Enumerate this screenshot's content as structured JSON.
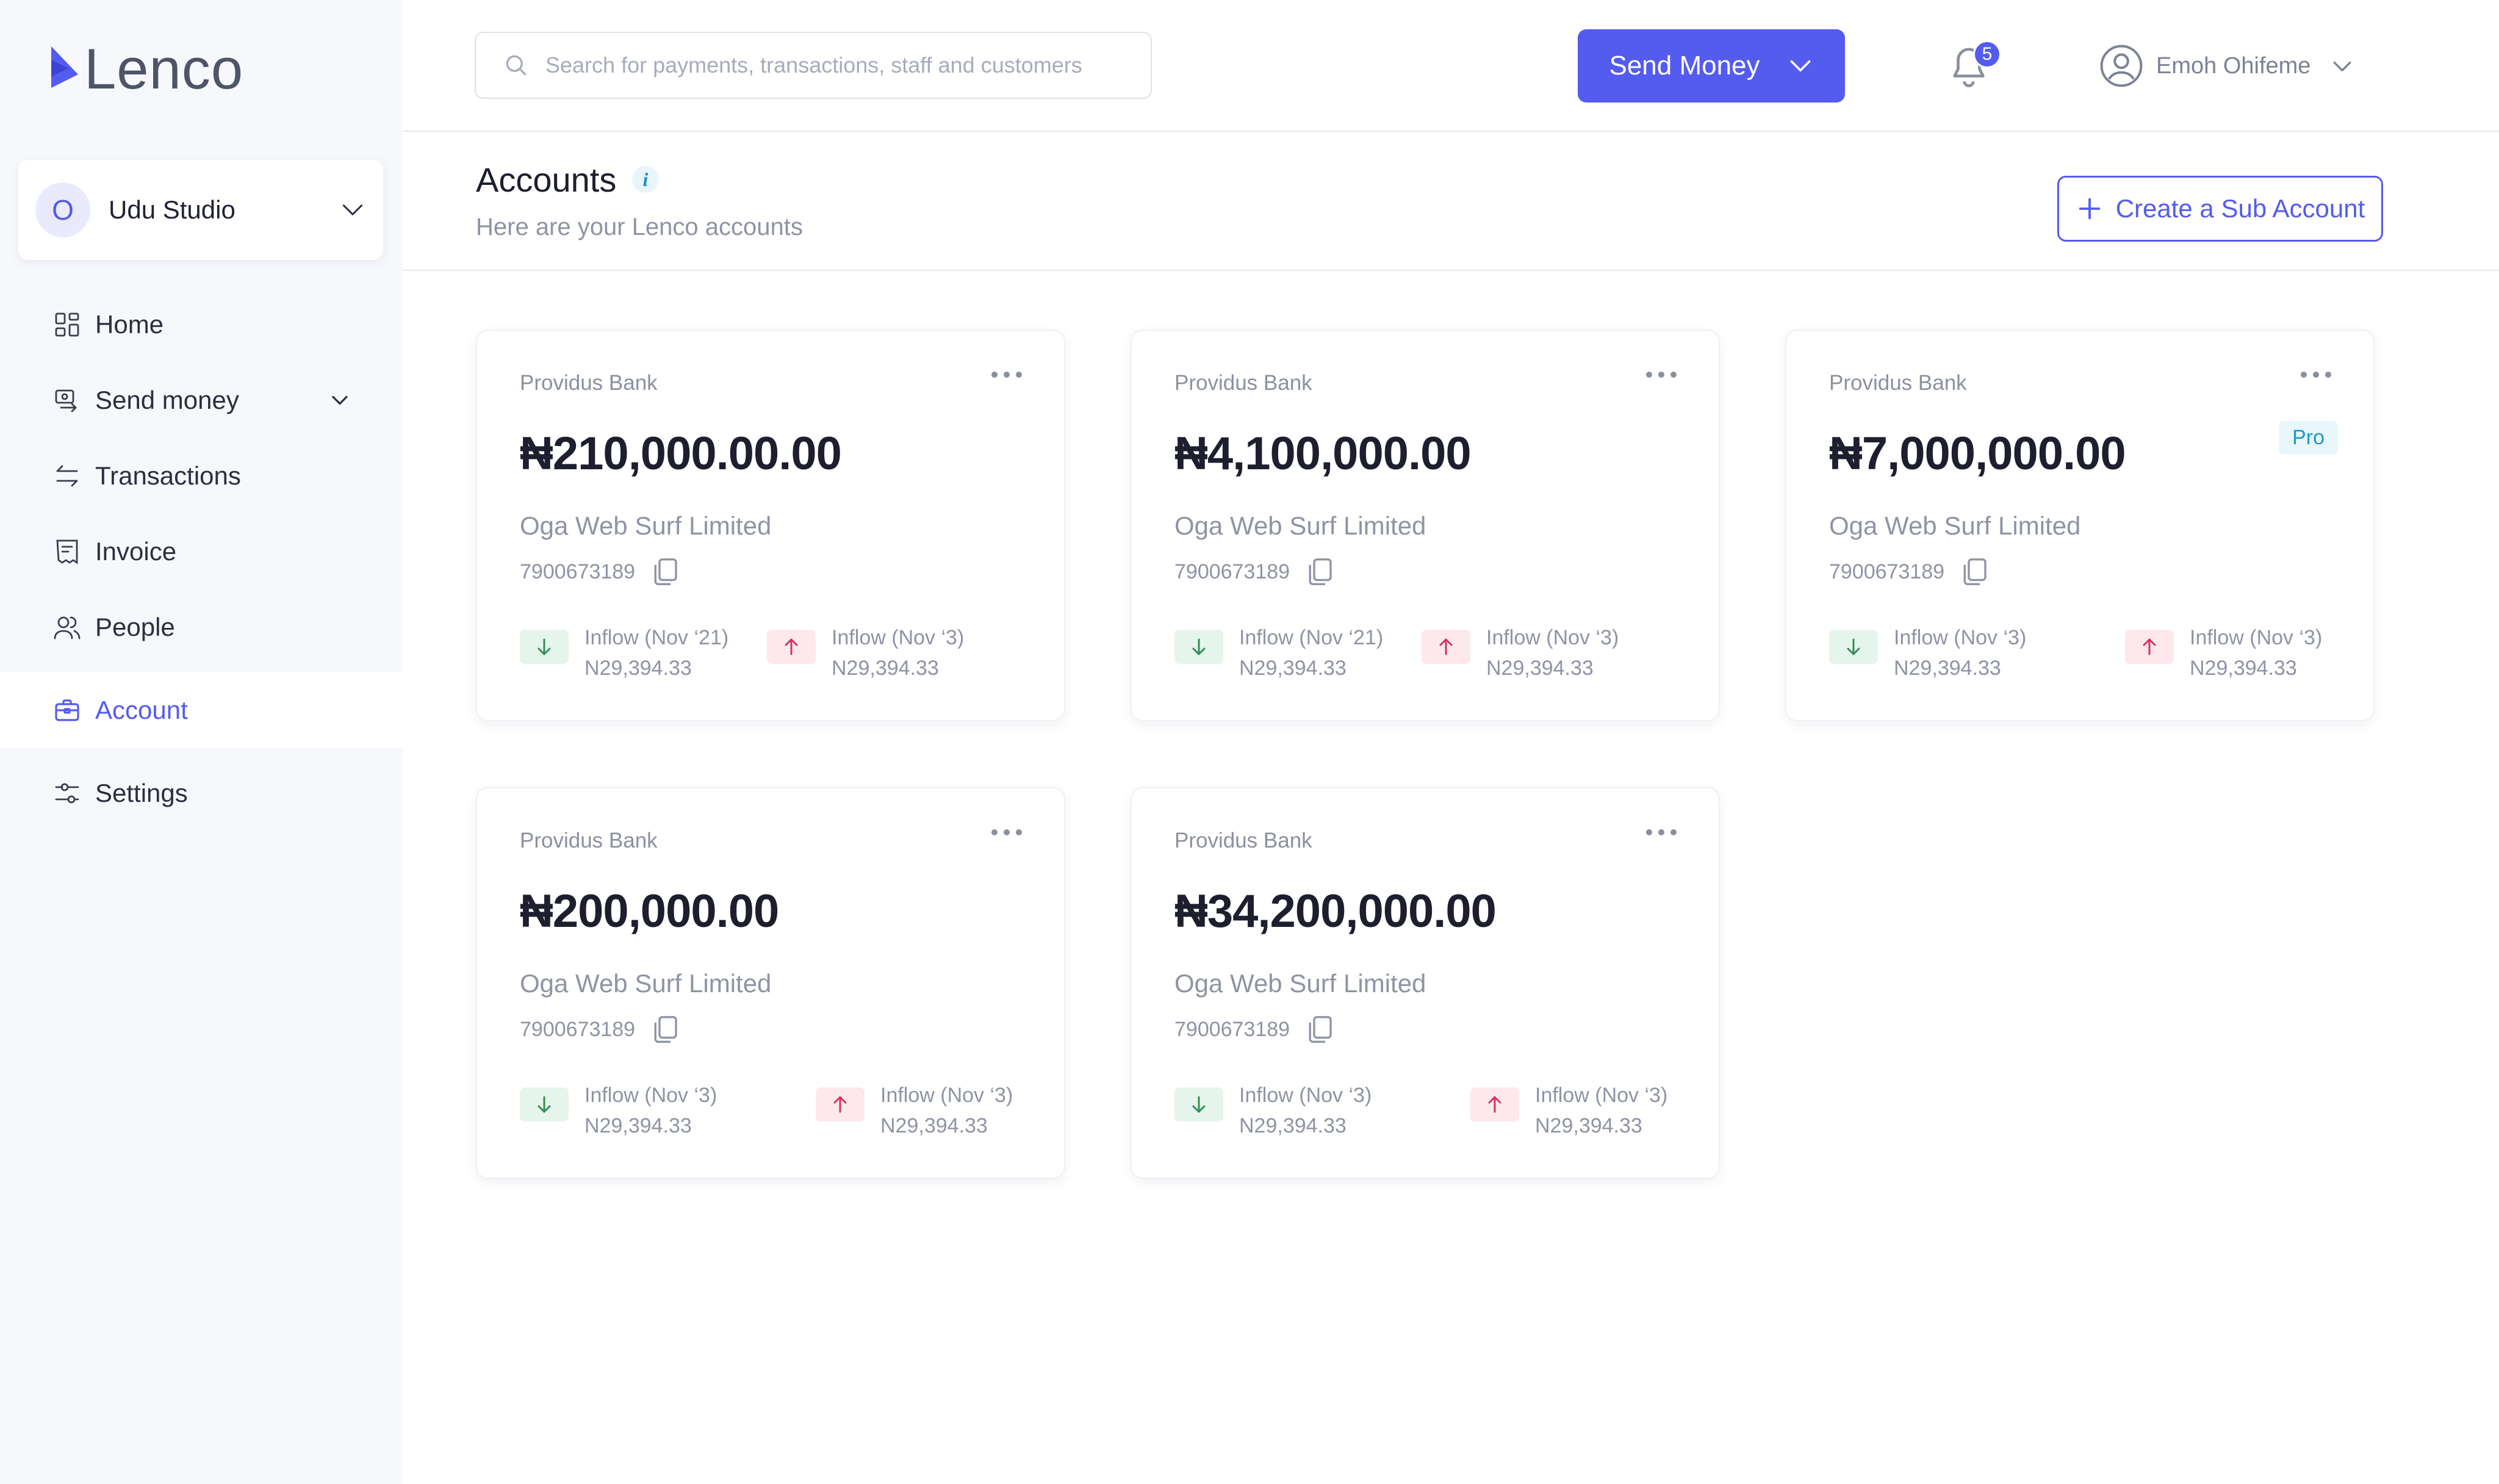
{
  "app": {
    "name": "Lenco"
  },
  "org": {
    "initial": "O",
    "name": "Udu Studio"
  },
  "nav": {
    "home": "Home",
    "send_money": "Send money",
    "transactions": "Transactions",
    "invoice": "Invoice",
    "people": "People",
    "account": "Account",
    "settings": "Settings"
  },
  "header": {
    "search_placeholder": "Search for payments, transactions, staff and customers",
    "send_button": "Send Money",
    "notification_count": "5",
    "user_name": "Emoh Ohifeme"
  },
  "page": {
    "title": "Accounts",
    "subtitle": "Here are your Lenco accounts",
    "create_button": "Create a Sub Account"
  },
  "colors": {
    "accent": "#545bef",
    "inflow_bg": "#e6f5ec",
    "inflow_arrow": "#2e8f58",
    "outflow_bg": "#fde8ed",
    "outflow_arrow": "#d2335f"
  },
  "accounts": [
    {
      "bank": "Providus Bank",
      "balance": "₦210,000.00.00",
      "badge": "",
      "holder": "Oga Web Surf Limited",
      "account_number": "7900673189",
      "inflow": {
        "label": "Inflow (Nov ‘21)",
        "value": "N29,394.33"
      },
      "outflow": {
        "label": "Inflow (Nov ‘3)",
        "value": "N29,394.33"
      }
    },
    {
      "bank": "Providus Bank",
      "balance": "₦4,100,000.00",
      "badge": "",
      "holder": "Oga Web Surf Limited",
      "account_number": "7900673189",
      "inflow": {
        "label": "Inflow (Nov ‘21)",
        "value": "N29,394.33"
      },
      "outflow": {
        "label": "Inflow (Nov ‘3)",
        "value": "N29,394.33"
      }
    },
    {
      "bank": "Providus Bank",
      "balance": "₦7,000,000.00",
      "badge": "Pro",
      "holder": "Oga Web Surf Limited",
      "account_number": "7900673189",
      "inflow": {
        "label": "Inflow (Nov ‘3)",
        "value": "N29,394.33"
      },
      "outflow": {
        "label": "Inflow (Nov ‘3)",
        "value": "N29,394.33"
      }
    },
    {
      "bank": "Providus Bank",
      "balance": "₦200,000.00",
      "badge": "",
      "holder": "Oga Web Surf Limited",
      "account_number": "7900673189",
      "inflow": {
        "label": "Inflow (Nov ‘3)",
        "value": "N29,394.33"
      },
      "outflow": {
        "label": "Inflow (Nov ‘3)",
        "value": "N29,394.33"
      }
    },
    {
      "bank": "Providus Bank",
      "balance": "₦34,200,000.00",
      "badge": "",
      "holder": "Oga Web Surf Limited",
      "account_number": "7900673189",
      "inflow": {
        "label": "Inflow (Nov ‘3)",
        "value": "N29,394.33"
      },
      "outflow": {
        "label": "Inflow (Nov ‘3)",
        "value": "N29,394.33"
      }
    }
  ]
}
